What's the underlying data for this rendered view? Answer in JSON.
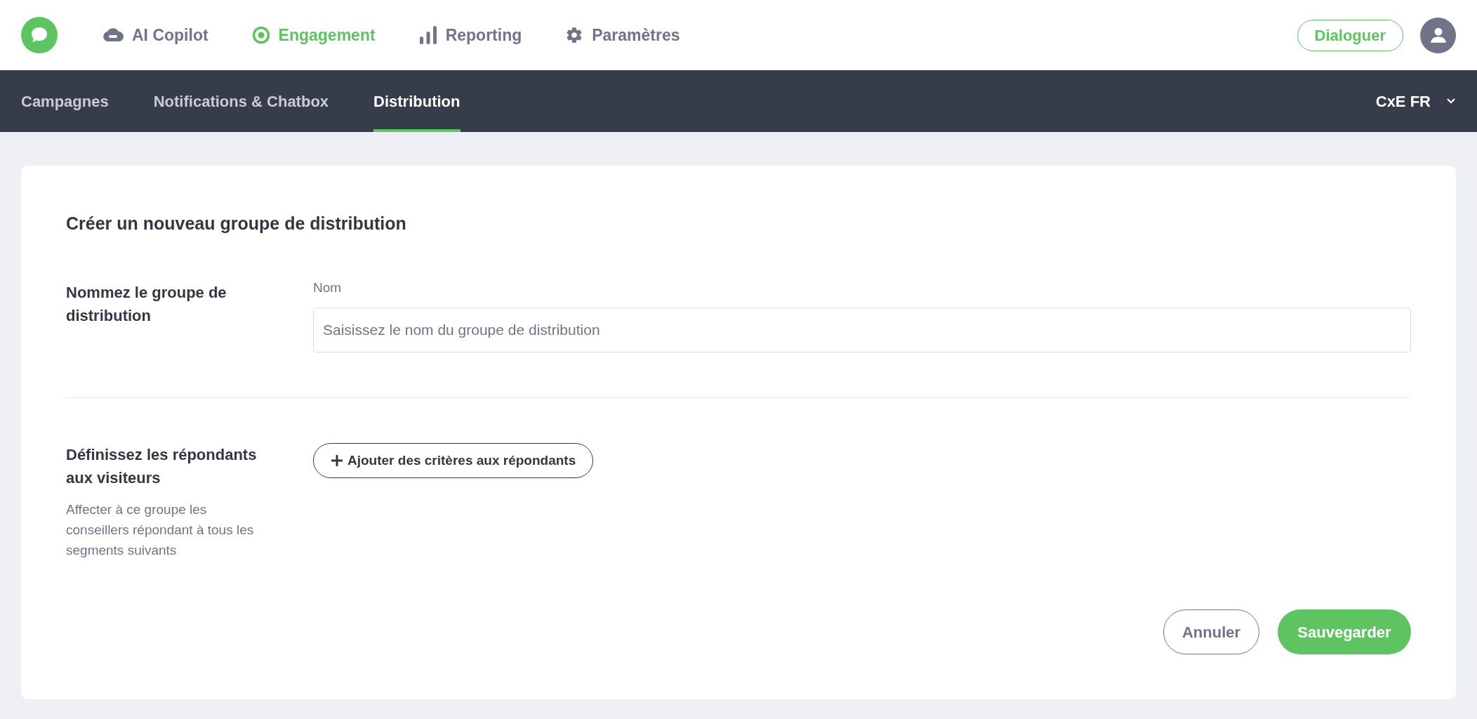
{
  "top_nav": [
    {
      "kind": "copilot",
      "label": "AI Copilot",
      "selected": false
    },
    {
      "kind": "engagement",
      "label": "Engagement",
      "selected": true
    },
    {
      "kind": "reporting",
      "label": "Reporting",
      "selected": false
    },
    {
      "kind": "settings",
      "label": "Paramètres",
      "selected": false
    }
  ],
  "cta_button": "Dialoguer",
  "tabs": [
    {
      "label": "Campagnes",
      "selected": false
    },
    {
      "label": "Notifications & Chatbox",
      "selected": false
    },
    {
      "label": "Distribution",
      "selected": true
    }
  ],
  "account_selector": "CxE FR",
  "form": {
    "title": "Créer un nouveau groupe de distribution",
    "name_section": {
      "heading": "Nommez le groupe de distribution",
      "field_label": "Nom",
      "placeholder": "Saisissez le nom du groupe de distribution"
    },
    "responders_section": {
      "heading": "Définissez les répondants aux visiteurs",
      "description": "Affecter à ce groupe les conseillers répondant à tous les segments suivants",
      "add_button": "Ajouter des critères aux répondants"
    },
    "buttons": {
      "cancel": "Annuler",
      "save": "Sauvegarder"
    }
  }
}
